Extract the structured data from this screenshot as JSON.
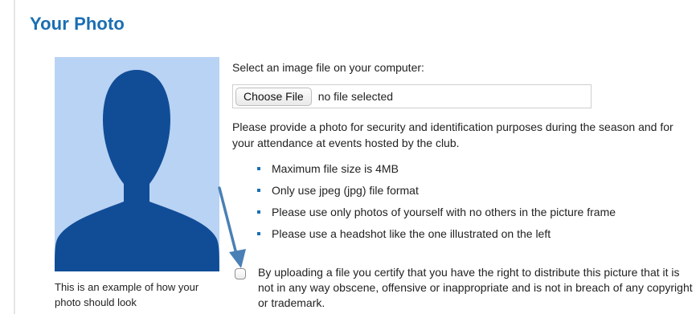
{
  "section": {
    "title": "Your Photo"
  },
  "example_photo": {
    "caption": "This is an example of how your photo should look",
    "background_color": "#b9d3f4",
    "silhouette_color": "#114d97",
    "icon": "person-silhouette-icon"
  },
  "upload": {
    "label": "Select an image file on your computer:",
    "choose_button_label": "Choose File",
    "file_status": "no file selected"
  },
  "purpose_text": "Please provide a photo for security and identification purposes during the season and for your attendance at events hosted by the club.",
  "rules": [
    "Maximum file size is 4MB",
    "Only use jpeg (jpg) file format",
    "Please use only photos of yourself with no others in the picture frame",
    "Please use a headshot like the one illustrated on the left"
  ],
  "certify": {
    "checked": false,
    "text": "By uploading a file you certify that you have the right to distribute this picture that it is not in any way obscene, offensive or inappropriate and is not in breach of any copyright or trademark."
  },
  "annotation": {
    "icon": "arrow-pointer-icon",
    "color": "#4a80b5"
  },
  "colors": {
    "accent": "#1a6fb3",
    "text": "#222222"
  }
}
